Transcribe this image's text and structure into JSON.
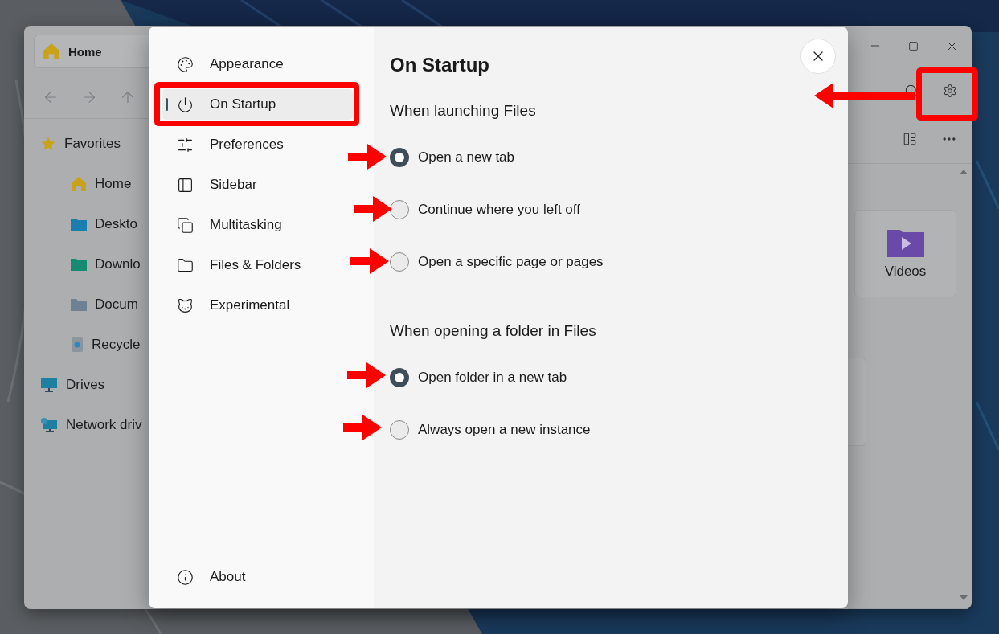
{
  "explorer": {
    "tab": {
      "label": "Home"
    },
    "sidebar": [
      {
        "label": "Favorites",
        "children": [
          {
            "label": "Home"
          },
          {
            "label": "Deskto"
          },
          {
            "label": "Downlo"
          },
          {
            "label": "Docum"
          },
          {
            "label": "Recycle"
          }
        ]
      },
      {
        "label": "Drives"
      },
      {
        "label": "Network driv"
      }
    ],
    "folders": [
      {
        "label": "Videos"
      }
    ]
  },
  "settings": {
    "nav": [
      {
        "label": "Appearance",
        "selected": false
      },
      {
        "label": "On Startup",
        "selected": true
      },
      {
        "label": "Preferences",
        "selected": false
      },
      {
        "label": "Sidebar",
        "selected": false
      },
      {
        "label": "Multitasking",
        "selected": false
      },
      {
        "label": "Files & Folders",
        "selected": false
      },
      {
        "label": "Experimental",
        "selected": false
      }
    ],
    "footer": {
      "label": "About"
    },
    "title": "On Startup",
    "groups": [
      {
        "heading": "When launching Files",
        "options": [
          {
            "label": "Open a new tab",
            "selected": true
          },
          {
            "label": "Continue where you left off",
            "selected": false
          },
          {
            "label": "Open a specific page or pages",
            "selected": false
          }
        ]
      },
      {
        "heading": "When opening a folder in Files",
        "options": [
          {
            "label": "Open folder in a new tab",
            "selected": true
          },
          {
            "label": "Always open a new instance",
            "selected": false
          }
        ]
      }
    ]
  }
}
